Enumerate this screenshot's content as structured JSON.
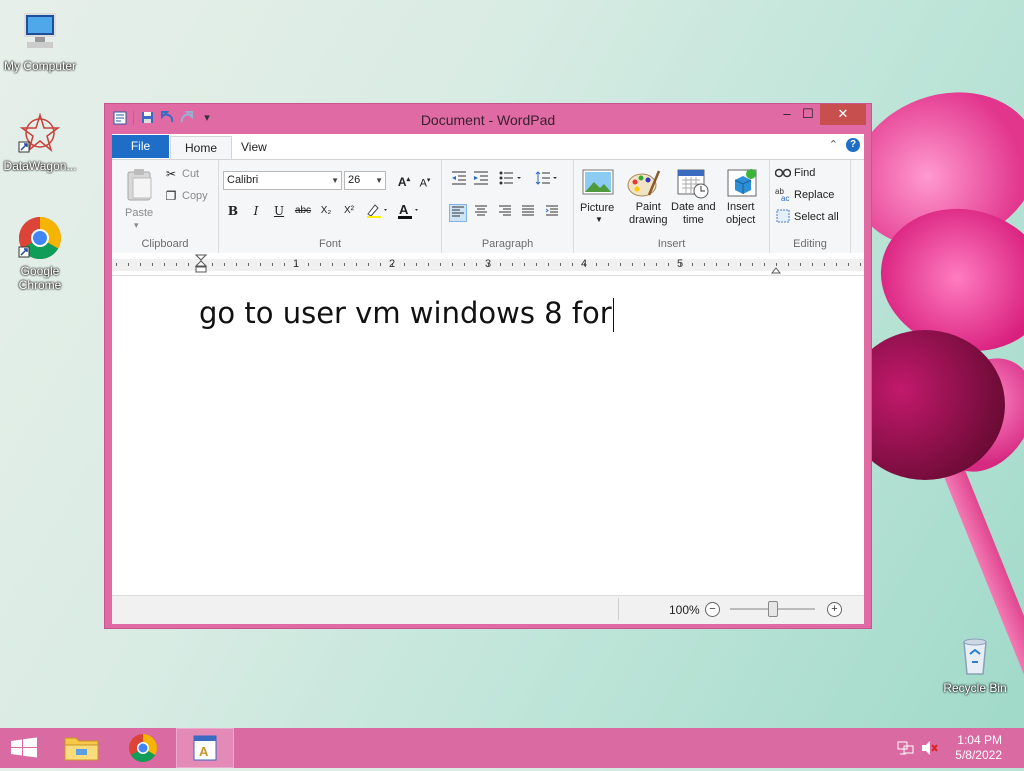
{
  "desktop": {
    "icons": [
      {
        "label": "My Computer"
      },
      {
        "label": "DataWagon..."
      },
      {
        "label": "Google Chrome"
      },
      {
        "label": "Recycle Bin"
      }
    ]
  },
  "window": {
    "title": "Document - WordPad",
    "controls": {
      "minimize": "–",
      "maximize": "☐",
      "close": "✕"
    },
    "tabs": {
      "file": "File",
      "home": "Home",
      "view": "View"
    },
    "help": "?"
  },
  "ribbon": {
    "clipboard": {
      "label": "Clipboard",
      "paste": "Paste",
      "cut": "Cut",
      "copy": "Copy"
    },
    "font": {
      "label": "Font",
      "family": "Calibri",
      "size": "26",
      "bold": "B",
      "italic": "I",
      "underline": "U",
      "strike": "abc",
      "subscript": "X₂",
      "superscript": "X²"
    },
    "paragraph": {
      "label": "Paragraph"
    },
    "insert": {
      "label": "Insert",
      "picture": "Picture",
      "paint_drawing": [
        "Paint",
        "drawing"
      ],
      "date_time": [
        "Date and",
        "time"
      ],
      "insert_object": [
        "Insert",
        "object"
      ]
    },
    "editing": {
      "label": "Editing",
      "find": "Find",
      "replace": "Replace",
      "select_all": "Select all"
    }
  },
  "ruler": {
    "numbers": [
      "1",
      "2",
      "3",
      "4",
      "5"
    ]
  },
  "document": {
    "text": "go to user vm windows 8 for"
  },
  "statusbar": {
    "zoom": "100%",
    "zoom_out": "−",
    "zoom_in": "+",
    "zoom_level": 1.0
  },
  "taskbar": {
    "clock_time": "1:04 PM",
    "clock_date": "5/8/2022"
  },
  "colors": {
    "window_frame": "#e06aa4",
    "taskbar": "#d96ba2",
    "file_tab": "#1e6ec8",
    "close_button": "#c7504f"
  }
}
